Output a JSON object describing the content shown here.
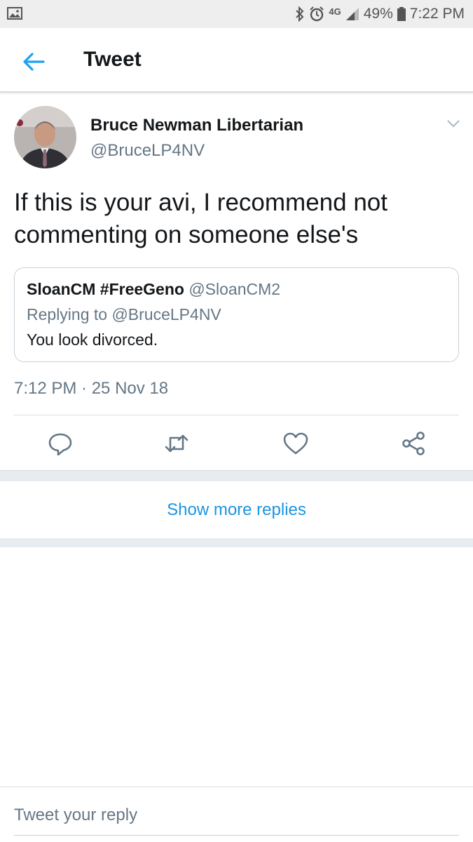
{
  "status_bar": {
    "battery": "49%",
    "time": "7:22 PM",
    "network": "4G",
    "icons": [
      "gallery-icon",
      "bluetooth-icon",
      "alarm-icon",
      "network-icon",
      "signal-icon",
      "battery-icon"
    ]
  },
  "header": {
    "title": "Tweet",
    "back_icon": "back-arrow-icon"
  },
  "tweet": {
    "author_name": "Bruce Newman Libertarian",
    "author_handle": "@BruceLP4NV",
    "text": "If this is your avi, I recommend not commenting on someone else's",
    "timestamp": "7:12 PM · 25 Nov 18",
    "quoted": {
      "name": "SloanCM #FreeGeno",
      "handle": "@SloanCM2",
      "replying_to": "Replying to @BruceLP4NV",
      "text": "You look divorced."
    },
    "actions": [
      "reply-icon",
      "retweet-icon",
      "like-icon",
      "share-icon"
    ]
  },
  "show_more_replies": "Show more replies",
  "reply_box": {
    "placeholder": "Tweet your reply"
  },
  "colors": {
    "accent": "#1da1f2",
    "link": "#1b95e0",
    "text_primary": "#14171a",
    "text_secondary": "#657786",
    "divider": "#d9dde0",
    "separator_bg": "#e6ecf0"
  }
}
